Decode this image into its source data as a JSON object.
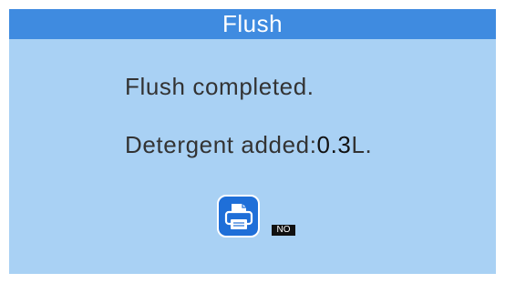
{
  "header": {
    "title": "Flush"
  },
  "main": {
    "message_line1": "Flush completed.",
    "message_line2_label": "Detergent added:",
    "message_line2_value": "0.3",
    "message_line2_unit": "L."
  },
  "actions": {
    "print_icon": "printer-icon",
    "print_status": "NO"
  },
  "colors": {
    "title_bar": "#3f8be0",
    "background": "#a9d1f4",
    "button": "#1f6fd8"
  }
}
